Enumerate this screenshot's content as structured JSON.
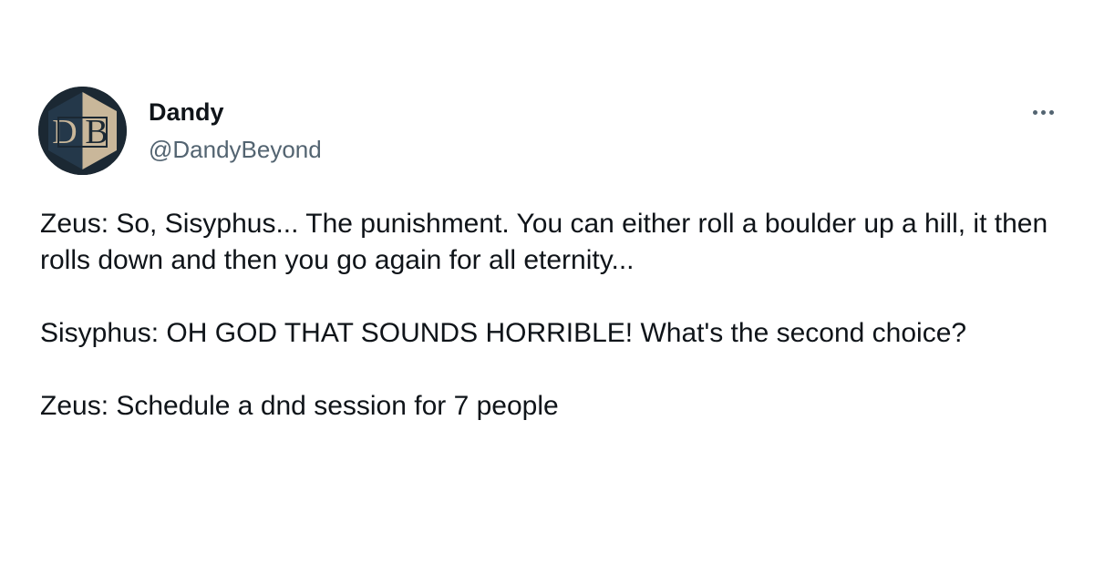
{
  "tweet": {
    "author": {
      "display_name": "Dandy",
      "handle": "@DandyBeyond",
      "avatar_icon": "dnd-beyond-logo-icon",
      "avatar_letters": "DB"
    },
    "more_icon": "ellipsis-icon",
    "paragraphs": [
      "Zeus: So, Sisyphus... The punishment. You can either roll a boulder up a hill, it then rolls down and then you go again for all eternity...",
      "Sisyphus: OH GOD THAT SOUNDS HORRIBLE! What's the second choice?",
      "Zeus: Schedule a dnd session for 7 people"
    ]
  },
  "colors": {
    "text_primary": "#0f1419",
    "text_secondary": "#536471",
    "background": "#ffffff",
    "avatar_dark": "#1b2833",
    "avatar_light": "#c9b79a"
  }
}
